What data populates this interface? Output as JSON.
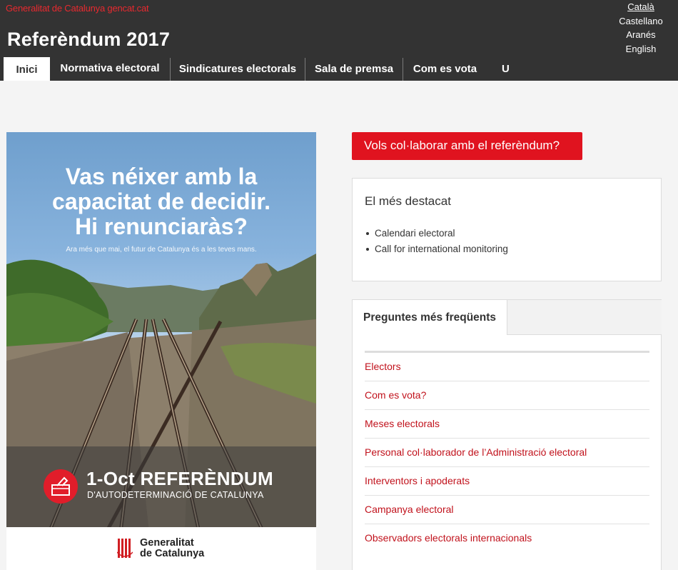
{
  "header": {
    "gencat_link": "Generalitat de Catalunya gencat.cat",
    "site_title": "Referèndum 2017",
    "languages": [
      "Català",
      "Castellano",
      "Aranés",
      "English"
    ],
    "active_language": "Català",
    "nav_tabs": [
      "Inici",
      "Normativa electoral",
      "Sindicatures electorals",
      "Sala de premsa",
      "Com es vota"
    ],
    "active_tab": "Inici",
    "nav_extra_glyph": "U"
  },
  "poster": {
    "headline_line1": "Vas néixer amb la",
    "headline_line2": "capacitat de decidir.",
    "headline_line3": "Hi renunciaràs?",
    "subheadline": "Ara més que mai, el futur de Catalunya és a les teves mans.",
    "referendum_title": "1-Oct REFERÈNDUM",
    "referendum_subtitle": "D'AUTODETERMINACIÓ DE CATALUNYA",
    "logo_line1": "Generalitat",
    "logo_line2": "de Catalunya",
    "colors": {
      "badge": "#e11d2a"
    }
  },
  "cta": {
    "label": "Vols col·laborar amb el referèndum?",
    "color": "#e0131f"
  },
  "highlights": {
    "title": "El més destacat",
    "items": [
      "Calendari electoral",
      "Call for international monitoring"
    ]
  },
  "faq": {
    "tab_label": "Preguntes més freqüents",
    "items": [
      "Electors",
      "Com es vota?",
      "Meses electorals",
      "Personal col·laborador de l’Administració electoral",
      "Interventors i apoderats",
      "Campanya electoral",
      "Observadors electorals internacionals"
    ],
    "link_color": "#c1121c"
  }
}
